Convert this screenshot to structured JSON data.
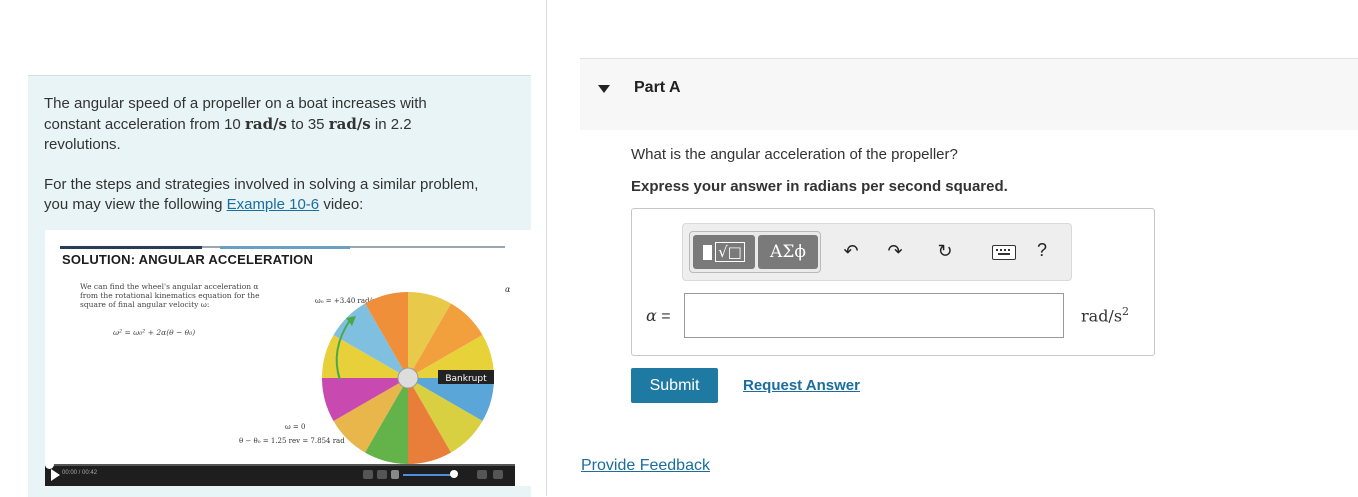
{
  "problem": {
    "text_part1": "The angular speed of a propeller on a boat increases with constant acceleration from 10 ",
    "unit_rad_s_1": "rad/s",
    "text_part2": " to 35 ",
    "unit_rad_s_2": "rad/s",
    "text_part3": " in 2.2 revolutions.",
    "video_intro": "For the steps and strategies involved in solving a similar problem, you may view the following ",
    "video_link": "Example 10-6",
    "video_suffix": " video:"
  },
  "video": {
    "slide_title": "SOLUTION: ANGULAR ACCELERATION",
    "slide_desc": "We can find the wheel's angular acceleration α from the rotational kinematics equation for the square of final angular velocity ω:",
    "slide_equation": "ω² = ω₀² + 2α(θ − θ₀)",
    "omega0_label": "ω₀ = +3.40 rad/s",
    "alpha_label": "α",
    "omega_final": "ω = 0",
    "theta_diff": "θ − θ₀ = 1.25 rev = 7.854 rad",
    "wheel_bankrupt": "Bankrupt",
    "time": "00:00 / 00:42",
    "progress": 0
  },
  "part": {
    "title": "Part A",
    "question": "What is the angular acceleration of the propeller?",
    "instruction": "Express your answer in radians per second squared.",
    "toolbar": {
      "templates_icon": "templates-icon",
      "symbols_label": "ΑΣϕ",
      "undo_icon": "undo-icon",
      "redo_icon": "redo-icon",
      "reset_icon": "reset-icon",
      "keyboard_icon": "keyboard-icon",
      "help_label": "?"
    },
    "variable": "α",
    "equals": " =",
    "answer_value": "",
    "unit": "rad/s",
    "unit_exp": "2",
    "submit_label": "Submit",
    "request_label": "Request Answer"
  },
  "feedback_label": "Provide Feedback",
  "colors": {
    "problem_bg": "#e9f4f7",
    "link": "#1a6d9c",
    "submit_bg": "#1f7aa3",
    "toolbar_button": "#7a7a7a"
  }
}
